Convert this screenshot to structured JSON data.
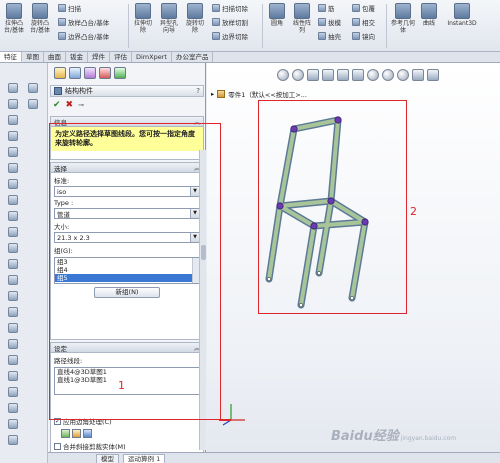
{
  "ribbon": {
    "big_buttons": [
      {
        "label": "拉伸凸台/基体",
        "icon": "extrude-boss-icon"
      },
      {
        "label": "旋转凸台/基体",
        "icon": "revolve-boss-icon"
      },
      {
        "label": "拉伸切除",
        "icon": "extrude-cut-icon"
      },
      {
        "label": "异型孔向导",
        "icon": "hole-wizard-icon"
      },
      {
        "label": "旋转切除",
        "icon": "revolved-cut-icon"
      },
      {
        "label": "圆角",
        "icon": "fillet-icon"
      },
      {
        "label": "线性阵列",
        "icon": "linear-pattern-icon"
      },
      {
        "label": "参考几何体",
        "icon": "reference-geometry-icon"
      },
      {
        "label": "曲线",
        "icon": "curves-icon"
      },
      {
        "label": "Instant3D",
        "icon": "instant3d-icon"
      }
    ],
    "small_buttons": [
      {
        "label": "扫描",
        "icon": "sweep-icon"
      },
      {
        "label": "放样凸台/基体",
        "icon": "loft-icon"
      },
      {
        "label": "边界凸台/基体",
        "icon": "boundary-boss-icon"
      },
      {
        "label": "扫描切除",
        "icon": "swept-cut-icon"
      },
      {
        "label": "放样切割",
        "icon": "lofted-cut-icon"
      },
      {
        "label": "边界切除",
        "icon": "boundary-cut-icon"
      },
      {
        "label": "筋",
        "icon": "rib-icon"
      },
      {
        "label": "拔模",
        "icon": "draft-icon"
      },
      {
        "label": "抽壳",
        "icon": "shell-icon"
      },
      {
        "label": "包覆",
        "icon": "wrap-icon"
      },
      {
        "label": "相交",
        "icon": "intersect-icon"
      },
      {
        "label": "镜向",
        "icon": "mirror-icon"
      }
    ]
  },
  "tabs": [
    "特征",
    "草图",
    "曲面",
    "钣金",
    "焊件",
    "评估",
    "DimXpert",
    "办公室产品"
  ],
  "pm": {
    "title": "结构构件",
    "help": "?",
    "message_header": "信息",
    "message": "为定义路径选择草图线段。您可按一指定角度来旋转轮廓。",
    "selection_header": "选择",
    "standard_label": "标准:",
    "standard_value": "iso",
    "type_label": "Type :",
    "type_value": "管道",
    "size_label": "大小:",
    "size_value": "21.3 x 2.3",
    "groups_label": "组(G):",
    "groups": [
      "组3",
      "组4",
      "组5"
    ],
    "new_group_button": "新组(N)",
    "settings_header": "设定",
    "path_label": "路径线段:",
    "path_segments": [
      "直线4@3D草图1",
      "直线1@3D草图1"
    ],
    "apply_corner": "应用边角处理(C)",
    "merge_miter": "合并斜接剪裁实体(M)"
  },
  "bottom_tabs": [
    "模型",
    "运动算例 1"
  ],
  "viewport": {
    "tree_text": "零件1（默认<<按加工>...",
    "watermark": "Baidu经验",
    "watermark_sub": "jingyan.baidu.com"
  },
  "annotations": {
    "label1": "1",
    "label2": "2"
  },
  "colors": {
    "annotation": "#e0262a",
    "selection": "#3b78d4",
    "message_bg": "#ffff99",
    "frame_member": "#8fae88"
  }
}
